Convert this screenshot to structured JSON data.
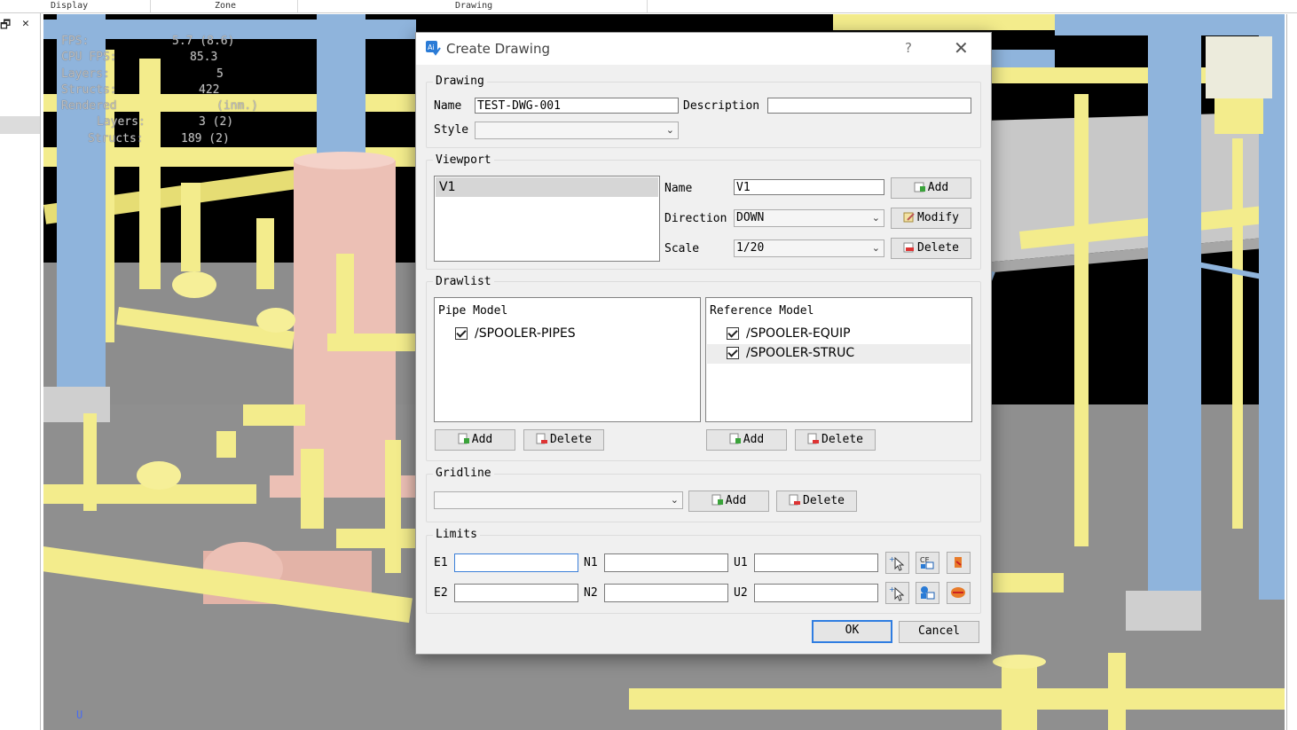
{
  "header": {
    "columns": [
      "Display",
      "Zone",
      "Drawing"
    ]
  },
  "left_panel": {
    "restore_glyph": "🗗",
    "close_glyph": "✕"
  },
  "viewport": {
    "stats": [
      {
        "key": "FPS:",
        "value": "5.7 (8.6)"
      },
      {
        "key": "CPU FPS:",
        "value": "85.3"
      },
      {
        "key": "Layers:",
        "value": "5"
      },
      {
        "key": "Structs:",
        "value": "422"
      },
      {
        "key": "Rendered",
        "value": "(inm.)"
      },
      {
        "key": "Layers:",
        "value": "3 (2)"
      },
      {
        "key": "Structs:",
        "value": "189 (2)"
      }
    ],
    "axis_label": "U",
    "colors": {
      "pipe": "#f3ec8c",
      "steel": "#8fb4dc",
      "vessel": "#ecc0b5",
      "floor": "#8f8f8f",
      "platform": "#c9c9c9"
    }
  },
  "dialog": {
    "title": "Create Drawing",
    "help": "?",
    "close": "✕",
    "drawing": {
      "group_label": "Drawing",
      "name_label": "Name",
      "name_value": "TEST-DWG-001",
      "description_label": "Description",
      "description_value": "",
      "style_label": "Style",
      "style_value": ""
    },
    "viewport": {
      "group_label": "Viewport",
      "list": [
        "V1"
      ],
      "name_label": "Name",
      "name_value": "V1",
      "direction_label": "Direction",
      "direction_value": "DOWN",
      "scale_label": "Scale",
      "scale_value": "1/20",
      "add": "Add",
      "modify": "Modify",
      "delete": "Delete"
    },
    "drawlist": {
      "group_label": "Drawlist",
      "pipe_model": {
        "header": "Pipe Model",
        "items": [
          "/SPOOLER-PIPES"
        ]
      },
      "reference_model": {
        "header": "Reference Model",
        "items": [
          "/SPOOLER-EQUIP",
          "/SPOOLER-STRUC"
        ]
      },
      "add": "Add",
      "delete": "Delete"
    },
    "gridline": {
      "group_label": "Gridline",
      "value": "",
      "add": "Add",
      "delete": "Delete"
    },
    "limits": {
      "group_label": "Limits",
      "e1": "E1",
      "n1": "N1",
      "u1": "U1",
      "e2": "E2",
      "n2": "N2",
      "u2": "U2",
      "e1_value": "",
      "n1_value": "",
      "u1_value": "",
      "e2_value": "",
      "n2_value": "",
      "u2_value": ""
    },
    "ok": "OK",
    "cancel": "Cancel"
  }
}
